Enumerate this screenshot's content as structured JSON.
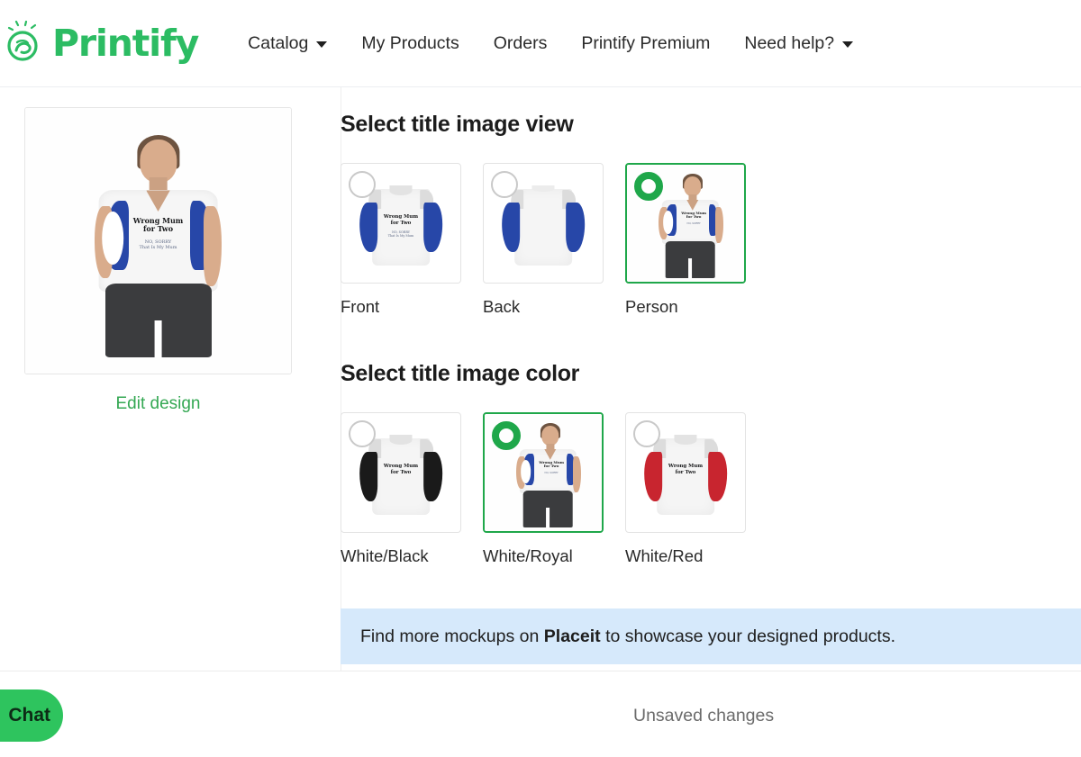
{
  "brand": {
    "name": "Printify",
    "logo_icon": "printify-hand-logo-icon",
    "color": "#2cbc63"
  },
  "nav": {
    "items": [
      {
        "label": "Catalog",
        "has_caret": true
      },
      {
        "label": "My Products",
        "has_caret": false
      },
      {
        "label": "Orders",
        "has_caret": false
      },
      {
        "label": "Printify Premium",
        "has_caret": false
      },
      {
        "label": "Need help?",
        "has_caret": true
      }
    ]
  },
  "preview": {
    "alt": "t-shirt mockup worn by a person",
    "edit_link": "Edit design"
  },
  "design": {
    "main_line_1": "Wrong Mum",
    "main_line_2": "for Two",
    "sub_line_1": "NO, SORRY",
    "sub_line_2": "That Is My Mum"
  },
  "sections": [
    {
      "id": "view",
      "title": "Select title image view",
      "options": [
        {
          "label": "Front",
          "selected": false,
          "kind": "tee",
          "accent": "#2747a8"
        },
        {
          "label": "Back",
          "selected": false,
          "kind": "tee-back",
          "accent": "#2747a8"
        },
        {
          "label": "Person",
          "selected": true,
          "kind": "person",
          "accent": "#2747a8"
        }
      ]
    },
    {
      "id": "color",
      "title": "Select title image color",
      "options": [
        {
          "label": "White/Black",
          "selected": false,
          "kind": "tee",
          "accent": "#1a1a1a"
        },
        {
          "label": "White/Royal",
          "selected": true,
          "kind": "person",
          "accent": "#2747a8"
        },
        {
          "label": "White/Red",
          "selected": false,
          "kind": "tee",
          "accent": "#c8252f"
        }
      ]
    }
  ],
  "banner": {
    "prefix": "Find more mockups on",
    "link": "Placeit",
    "suffix": "to showcase your designed products.",
    "background": "#d6e9fb"
  },
  "footer": {
    "chat_label": "Chat",
    "status": "Unsaved changes"
  },
  "colors": {
    "green": "#1fa74a",
    "brand_green": "#2cbc63",
    "link_green": "#34a853"
  }
}
